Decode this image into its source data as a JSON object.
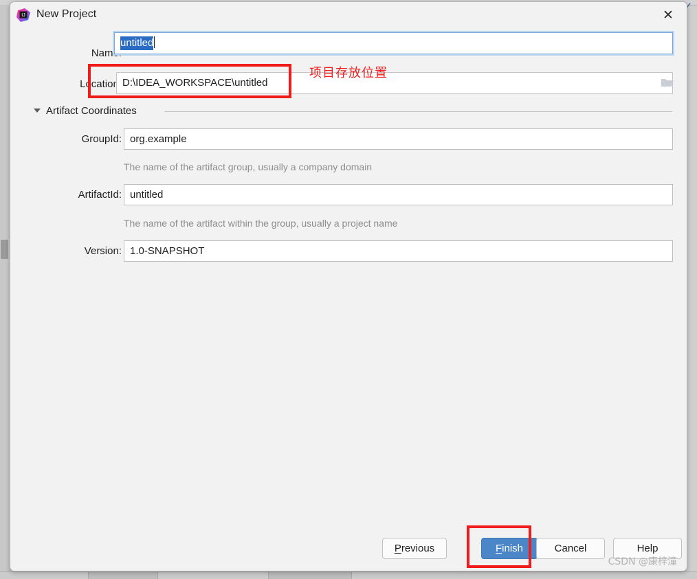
{
  "window": {
    "title": "New Project",
    "app_icon": "intellij-idea-icon",
    "close_label": "✕"
  },
  "form": {
    "name": {
      "label": "Name:",
      "value": "untitled",
      "selected": true
    },
    "location": {
      "label": "Location:",
      "value": "D:\\IDEA_WORKSPACE\\untitled",
      "browse_icon": "folder-icon"
    }
  },
  "artifact_section": {
    "title": "Artifact Coordinates",
    "expanded": true,
    "toggle_icon": "triangle-down-icon",
    "fields": [
      {
        "label": "GroupId:",
        "value": "org.example",
        "hint": "The name of the artifact group, usually a company domain"
      },
      {
        "label": "ArtifactId:",
        "value": "untitled",
        "hint": "The name of the artifact within the group, usually a project name"
      },
      {
        "label": "Version:",
        "value": "1.0-SNAPSHOT",
        "hint": ""
      }
    ]
  },
  "buttons": {
    "previous": {
      "prefix": "",
      "mnemonic": "P",
      "suffix": "revious"
    },
    "finish": {
      "prefix": "",
      "mnemonic": "F",
      "suffix": "inish"
    },
    "cancel": {
      "label": "Cancel"
    },
    "help": {
      "label": "Help"
    }
  },
  "annotations": {
    "location_note": "项目存放位置",
    "box_color": "#ef1c1c"
  },
  "watermark": "CSDN @康梓潼",
  "colors": {
    "dialog_bg": "#f2f2f2",
    "primary_button": "#4a86c8",
    "selection": "#2a6cc4",
    "hint_text": "#8d8d8d",
    "annotation_red": "#ef1c1c"
  }
}
